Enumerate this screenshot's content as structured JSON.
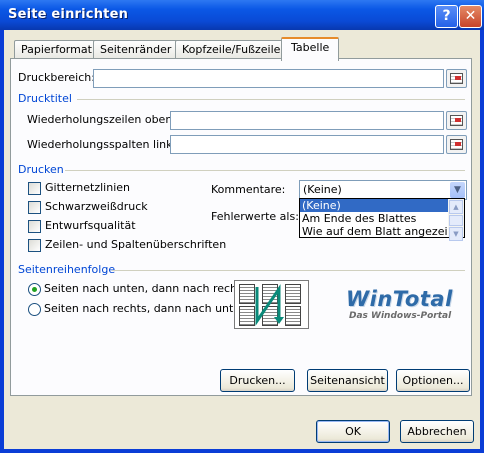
{
  "window": {
    "title": "Seite einrichten",
    "help_glyph": "?",
    "close_glyph": "✕"
  },
  "tabs": [
    {
      "label": "Papierformat"
    },
    {
      "label": "Seitenränder"
    },
    {
      "label": "Kopfzeile/Fußzeile"
    },
    {
      "label": "Tabelle",
      "active": true
    }
  ],
  "print_area": {
    "label": "Druckbereich:",
    "value": ""
  },
  "print_titles": {
    "heading": "Drucktitel",
    "rows_label": "Wiederholungszeilen oben:",
    "rows_value": "",
    "cols_label": "Wiederholungsspalten links:",
    "cols_value": ""
  },
  "print": {
    "heading": "Drucken",
    "checkboxes": [
      {
        "label": "Gitternetzlinien",
        "checked": false
      },
      {
        "label": "Schwarzweißdruck",
        "checked": false
      },
      {
        "label": "Entwurfsqualität",
        "checked": false
      },
      {
        "label": "Zeilen- und Spaltenüberschriften",
        "checked": false
      }
    ],
    "comments_label": "Kommentare:",
    "comments_value": "(Keine)",
    "comments_options": [
      "(Keine)",
      "Am Ende des Blattes",
      "Wie auf dem Blatt angezeigt"
    ],
    "errors_label": "Fehlerwerte als:"
  },
  "page_order": {
    "heading": "Seitenreihenfolge",
    "options": [
      {
        "label": "Seiten nach unten, dann nach rechts",
        "selected": true
      },
      {
        "label": "Seiten nach rechts, dann nach unten",
        "selected": false
      }
    ]
  },
  "watermark": {
    "brand": "WinTotal",
    "tagline": "Das Windows-Portal"
  },
  "buttons": {
    "print": "Drucken...",
    "preview": "Seitenansicht",
    "options": "Optionen...",
    "ok": "OK",
    "cancel": "Abbrechen"
  },
  "colors": {
    "group_heading": "#0046d5",
    "titlebar": "#0a4ad6",
    "selection": "#316ac5",
    "active_tab_accent": "#e68b2c"
  }
}
